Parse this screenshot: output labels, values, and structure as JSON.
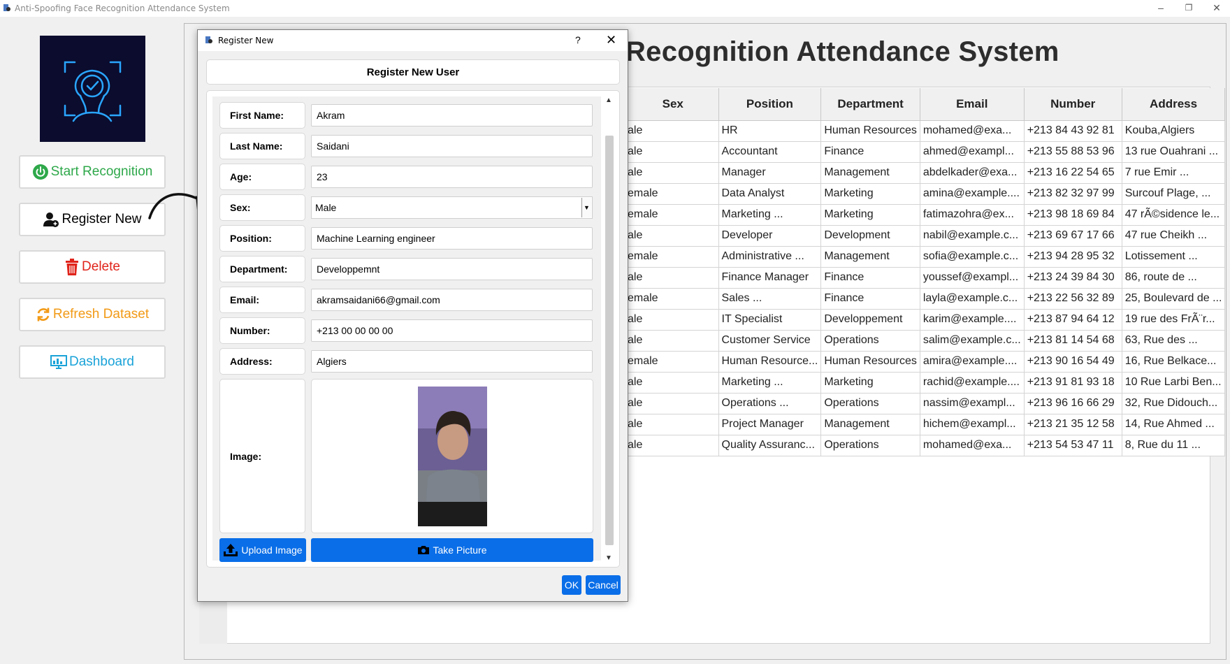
{
  "window": {
    "title": "Anti-Spoofing Face Recognition Attendance System",
    "controls": {
      "minimize": "–",
      "restore": "❐",
      "close": "✕"
    }
  },
  "sidebar": {
    "buttons": [
      {
        "label": "Start Recognition",
        "icon": "power-icon",
        "color": "#2ea84a"
      },
      {
        "label": "Register New",
        "icon": "user-add-icon",
        "color": "#000000"
      },
      {
        "label": "Delete",
        "icon": "trash-icon",
        "color": "#e0241b"
      },
      {
        "label": "Refresh Dataset",
        "icon": "refresh-icon",
        "color": "#f29a16"
      },
      {
        "label": "Dashboard",
        "icon": "dashboard-icon",
        "color": "#1aa3d8"
      }
    ]
  },
  "main": {
    "heading": "Recognition Attendance System",
    "table": {
      "columns": [
        "Sex",
        "Position",
        "Department",
        "Email",
        "Number",
        "Address"
      ],
      "rows": [
        [
          "ale",
          "HR",
          "Human Resources",
          "mohamed@exa...",
          "+213 84 43 92 81",
          "Kouba,Algiers"
        ],
        [
          "ale",
          "Accountant",
          "Finance",
          "ahmed@exampl...",
          "+213 55 88 53 96",
          "13 rue Ouahrani ..."
        ],
        [
          "ale",
          "Manager",
          "Management",
          "abdelkader@exa...",
          "+213 16 22 54 65",
          "7 rue Emir ..."
        ],
        [
          "emale",
          "Data Analyst",
          "Marketing",
          "amina@example....",
          "+213 82 32 97 99",
          "Surcouf Plage, ..."
        ],
        [
          "emale",
          "Marketing ...",
          "Marketing",
          "fatimazohra@ex...",
          "+213 98 18 69 84",
          "47 rÃ©sidence le..."
        ],
        [
          "ale",
          "Developer",
          "Development",
          "nabil@example.c...",
          "+213 69 67 17 66",
          "47 rue Cheikh ..."
        ],
        [
          "emale",
          "Administrative ...",
          "Management",
          "sofia@example.c...",
          "+213 94 28 95 32",
          "Lotissement ..."
        ],
        [
          "ale",
          "Finance Manager",
          "Finance",
          "youssef@exampl...",
          "+213 24 39 84 30",
          "86, route de ..."
        ],
        [
          "emale",
          "Sales ...",
          "Finance",
          "layla@example.c...",
          "+213 22 56 32 89",
          "25, Boulevard de ..."
        ],
        [
          "ale",
          "IT Specialist",
          "Developpement",
          "karim@example....",
          "+213 87 94 64 12",
          "19 rue des FrÃ¨r..."
        ],
        [
          "ale",
          "Customer Service",
          "Operations",
          "salim@example.c...",
          "+213 81 14 54 68",
          "63, Rue des ..."
        ],
        [
          "emale",
          "Human Resource...",
          "Human Resources",
          "amira@example....",
          "+213 90 16 54 49",
          "16, Rue Belkace..."
        ],
        [
          "ale",
          "Marketing ...",
          "Marketing",
          "rachid@example....",
          "+213 91 81 93 18",
          "10 Rue Larbi Ben..."
        ],
        [
          "ale",
          "Operations ...",
          "Operations",
          "nassim@exampl...",
          "+213 96 16 66 29",
          "32, Rue Didouch..."
        ],
        [
          "ale",
          "Project Manager",
          "Management",
          "hichem@exampl...",
          "+213 21 35 12 58",
          "14, Rue Ahmed ..."
        ],
        [
          "ale",
          "Quality Assuranc...",
          "Operations",
          "mohamed@exa...",
          "+213 54 53 47 11",
          "8, Rue du 11 ..."
        ]
      ]
    }
  },
  "dialog": {
    "title": "Register New",
    "help": "?",
    "close": "✕",
    "header": "Register New User",
    "fields": [
      {
        "label": "First Name:",
        "value": "Akram"
      },
      {
        "label": "Last Name:",
        "value": "Saidani"
      },
      {
        "label": "Age:",
        "value": "23"
      },
      {
        "label": "Sex:",
        "value": "Male"
      },
      {
        "label": "Position:",
        "value": "Machine Learning engineer"
      },
      {
        "label": "Department:",
        "value": "Developpemnt"
      },
      {
        "label": "Email:",
        "value": "akramsaidani66@gmail.com"
      },
      {
        "label": "Number:",
        "value": "+213 00 00 00 00"
      },
      {
        "label": "Address:",
        "value": "Algiers"
      }
    ],
    "image_label": "Image:",
    "upload_label": "Upload Image",
    "take_label": "Take Picture",
    "ok_label": "OK",
    "cancel_label": "Cancel",
    "accent": "#0a6ee8"
  }
}
